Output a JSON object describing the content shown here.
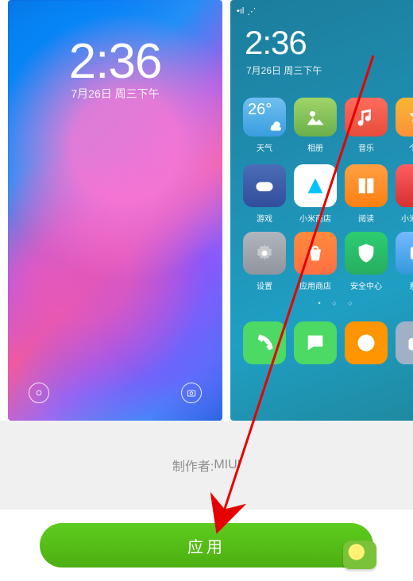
{
  "lockscreen": {
    "time": "2:36",
    "date": "7月26日 周三下午"
  },
  "homescreen": {
    "time": "2:36",
    "date": "7月26日 周三下午",
    "status": {
      "cell": "•ıl",
      "wifi": "⋰",
      "battery_icon": "▮"
    },
    "widgets": [
      {
        "label": "天气",
        "icon": "weather",
        "temp": "26°"
      },
      {
        "label": "相册",
        "icon": "gallery"
      },
      {
        "label": "音乐",
        "icon": "music"
      },
      {
        "label": "个性",
        "icon": "per"
      }
    ],
    "apps": [
      {
        "label": "游戏",
        "icon": "game"
      },
      {
        "label": "小米商店",
        "icon": "store"
      },
      {
        "label": "阅读",
        "icon": "read"
      },
      {
        "label": "小米视频",
        "icon": "video"
      },
      {
        "label": "设置",
        "icon": "set"
      },
      {
        "label": "应用商店",
        "icon": "app"
      },
      {
        "label": "安全中心",
        "icon": "sec"
      },
      {
        "label": "系统",
        "icon": "sys"
      }
    ],
    "dock": [
      {
        "label": "",
        "icon": "phone"
      },
      {
        "label": "",
        "icon": "sms"
      },
      {
        "label": "",
        "icon": "browser"
      },
      {
        "label": "",
        "icon": "cam"
      }
    ]
  },
  "footer": {
    "author_label": "制作者: ",
    "author_value": "MIUI",
    "apply_label": "应用"
  }
}
